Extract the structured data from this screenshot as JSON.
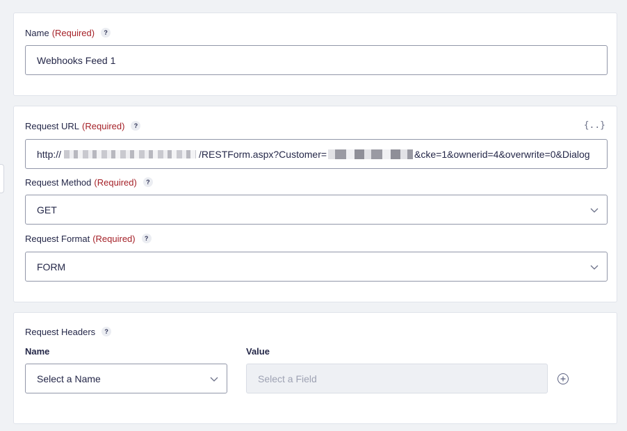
{
  "name_section": {
    "label": "Name",
    "required": "(Required)",
    "help": "?",
    "value": "Webhooks Feed 1"
  },
  "request_section": {
    "url": {
      "label": "Request URL",
      "required": "(Required)",
      "help": "?",
      "merge_tag_icon": "{..}",
      "value_prefix": "http://",
      "value_middle": "/RESTForm.aspx?Customer=",
      "value_suffix": "&cke=1&ownerid=4&overwrite=0&Dialog"
    },
    "method": {
      "label": "Request Method",
      "required": "(Required)",
      "help": "?",
      "value": "GET"
    },
    "format": {
      "label": "Request Format",
      "required": "(Required)",
      "help": "?",
      "value": "FORM"
    }
  },
  "headers_section": {
    "label": "Request Headers",
    "help": "?",
    "name_col": "Name",
    "value_col": "Value",
    "name_placeholder": "Select a Name",
    "value_placeholder": "Select a Field"
  },
  "icons": {
    "help": "question-mark-icon",
    "chevron": "chevron-down-icon",
    "merge_tag": "merge-tag-icon",
    "add": "plus-circle-icon"
  },
  "colors": {
    "required": "#a52128",
    "border": "#9196a8",
    "disabled_bg": "#eef0f4"
  }
}
